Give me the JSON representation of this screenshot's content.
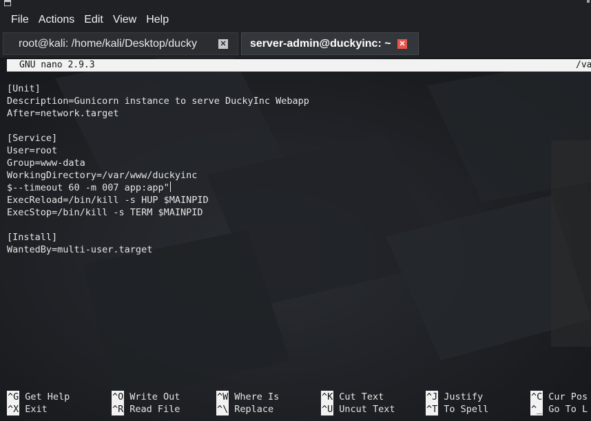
{
  "menubar": {
    "items": [
      "File",
      "Actions",
      "Edit",
      "View",
      "Help"
    ]
  },
  "tabs": [
    {
      "label": "root@kali: /home/kali/Desktop/ducky",
      "active": false,
      "close_icon": "close-icon"
    },
    {
      "label": "server-admin@duckyinc: ~",
      "active": true,
      "close_icon": "close-icon"
    }
  ],
  "nano": {
    "version": "GNU nano 2.9.3",
    "filename_fragment": "/va",
    "lines": [
      "[Unit]",
      "Description=Gunicorn instance to serve DuckyInc Webapp",
      "After=network.target",
      "",
      "[Service]",
      "User=root",
      "Group=www-data",
      "WorkingDirectory=/var/www/duckyinc",
      "$--timeout 60 -m 007 app:app\"",
      "ExecReload=/bin/kill -s HUP $MAINPID",
      "ExecStop=/bin/kill -s TERM $MAINPID",
      "",
      "[Install]",
      "WantedBy=multi-user.target"
    ],
    "cursor_line": 8
  },
  "shortcuts": [
    [
      {
        "key": "^G",
        "label": "Get Help"
      },
      {
        "key": "^O",
        "label": "Write Out"
      },
      {
        "key": "^W",
        "label": "Where Is"
      },
      {
        "key": "^K",
        "label": "Cut Text"
      },
      {
        "key": "^J",
        "label": "Justify"
      },
      {
        "key": "^C",
        "label": "Cur Pos"
      }
    ],
    [
      {
        "key": "^X",
        "label": "Exit"
      },
      {
        "key": "^R",
        "label": "Read File"
      },
      {
        "key": "^\\",
        "label": "Replace"
      },
      {
        "key": "^U",
        "label": "Uncut Text"
      },
      {
        "key": "^T",
        "label": "To Spell"
      },
      {
        "key": "^_",
        "label": "Go To L"
      }
    ]
  ],
  "colors": {
    "chrome": "#1f2125",
    "terminal_bg": "#1c1e22",
    "active_tab_close": "#e8564a",
    "reverse_video": "#f2f2f2"
  }
}
